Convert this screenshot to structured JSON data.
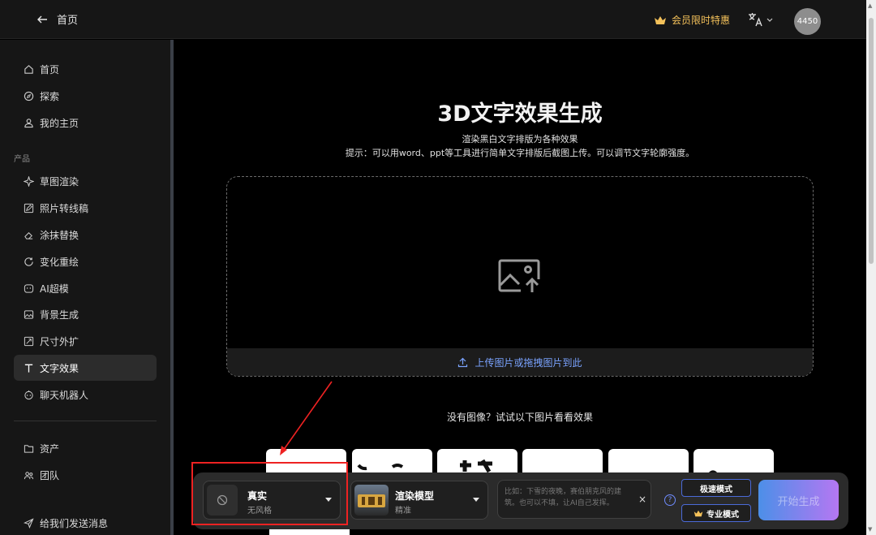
{
  "topbar": {
    "back_label": "首页",
    "promo_label": "会员限时特惠",
    "avatar_text": "4450"
  },
  "sidebar": {
    "items_top": [
      {
        "label": "首页",
        "icon": "home-icon"
      },
      {
        "label": "探索",
        "icon": "compass-icon"
      },
      {
        "label": "我的主页",
        "icon": "user-icon"
      }
    ],
    "section_label": "产品",
    "products": [
      {
        "label": "草图渲染",
        "icon": "sparkle-icon"
      },
      {
        "label": "照片转线稿",
        "icon": "pencil-icon"
      },
      {
        "label": "涂抹替换",
        "icon": "eraser-icon"
      },
      {
        "label": "变化重绘",
        "icon": "refresh-icon"
      },
      {
        "label": "AI超模",
        "icon": "face-icon"
      },
      {
        "label": "背景生成",
        "icon": "image-icon"
      },
      {
        "label": "尺寸外扩",
        "icon": "expand-icon"
      },
      {
        "label": "文字效果",
        "icon": "text-icon",
        "active": true
      },
      {
        "label": "聊天机器人",
        "icon": "bot-icon"
      }
    ],
    "items_bottom": [
      {
        "label": "资产",
        "icon": "folder-icon"
      },
      {
        "label": "团队",
        "icon": "team-icon"
      },
      {
        "label": "给我们发送消息",
        "icon": "send-icon"
      }
    ]
  },
  "main": {
    "title": "3D文字效果生成",
    "subtitle": "渲染黑白文字排版为各种效果",
    "hint": "提示：可以用word、ppt等工具进行简单文字排版后截图上传。可以调节文字轮廓强度。",
    "upload_label": "上传图片或拖拽图片到此",
    "samples_caption": "没有图像？试试以下图片看看效果"
  },
  "controls": {
    "style_name": "真实",
    "style_sub": "无风格",
    "model_name": "渲染模型",
    "model_sub": "精准",
    "prompt_placeholder": "比如：下雪的夜晚，赛伯朋克风的建筑。也可以不填，让AI自己发挥。",
    "clear_symbol": "×",
    "help_symbol": "?",
    "fast_mode": "极速模式",
    "pro_mode": "专业模式",
    "start_label": "开始生成"
  },
  "colors": {
    "accent_gold": "#f4c15a",
    "link_blue": "#7aa3ff",
    "annotation_red": "#e22222"
  }
}
